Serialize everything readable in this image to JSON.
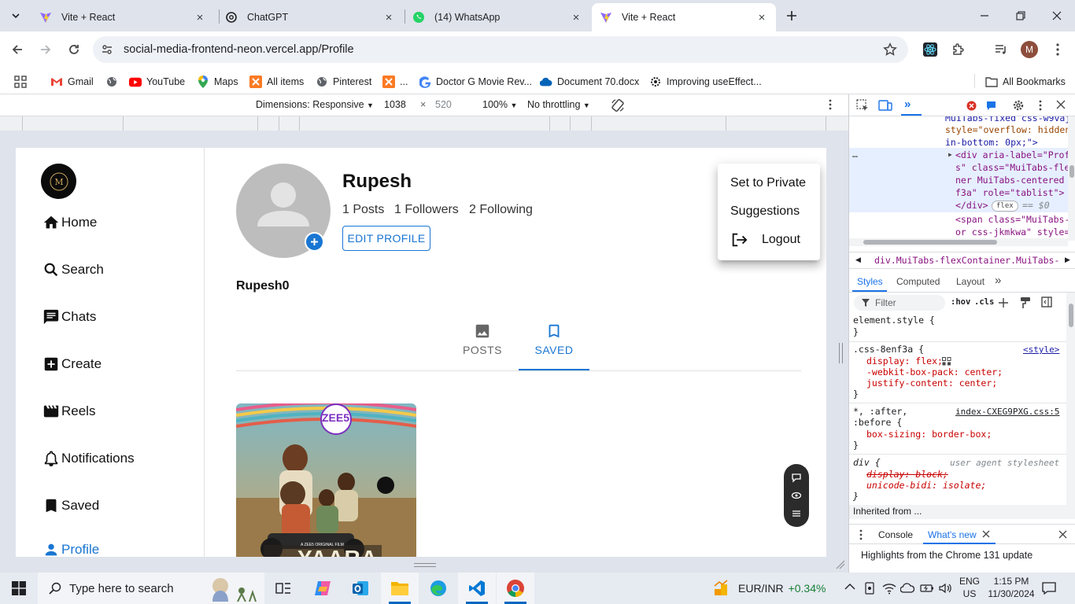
{
  "tabs": [
    {
      "title": "Vite + React",
      "favicon": "vite-icon"
    },
    {
      "title": "ChatGPT",
      "favicon": "chatgpt-icon"
    },
    {
      "title": "(14) WhatsApp",
      "favicon": "whatsapp-icon"
    },
    {
      "title": "Vite + React",
      "favicon": "vite-icon"
    }
  ],
  "address": {
    "url": "social-media-frontend-neon.vercel.app/Profile"
  },
  "bookmarks": [
    "Gmail",
    "YouTube",
    "Maps",
    "All items",
    "Pinterest",
    "...",
    "Doctor G Movie Rev...",
    "Document 70.docx",
    "Improving useEffect...",
    "All Bookmarks"
  ],
  "devicebar": {
    "dimensions": "Dimensions: Responsive",
    "width": "1038",
    "times": "×",
    "height": "520",
    "zoom": "100%",
    "throttle": "No throttling"
  },
  "sidebar": {
    "items": [
      {
        "label": "Home",
        "icon": "home-icon"
      },
      {
        "label": "Search",
        "icon": "search-icon"
      },
      {
        "label": "Chats",
        "icon": "chat-icon"
      },
      {
        "label": "Create",
        "icon": "add-box-icon"
      },
      {
        "label": "Reels",
        "icon": "movie-icon"
      },
      {
        "label": "Notifications",
        "icon": "bell-icon"
      },
      {
        "label": "Saved",
        "icon": "bookmark-icon"
      },
      {
        "label": "Profile",
        "icon": "person-icon"
      }
    ]
  },
  "profile": {
    "name": "Rupesh",
    "posts": "1 Posts",
    "followers": "1 Followers",
    "following": "2 Following",
    "edit_label": "EDIT PROFILE",
    "username": "Rupesh0",
    "tabs": [
      "POSTS",
      "SAVED"
    ],
    "active_tab": "SAVED"
  },
  "menu": {
    "items": [
      "Set to Private",
      "Suggestions",
      "Logout"
    ]
  },
  "poster": {
    "brand": "ZEE5",
    "title": "YAARA",
    "tagline": "A ZEE5 ORIGINAL FILM"
  },
  "devtools": {
    "html_lines": [
      "MuiTabs-fixed css-w9vaj",
      "style=\"overflow: hidden",
      "in-bottom: 0px;\">",
      "<div aria-label=\"Prof",
      "s\" class=\"MuiTabs-fle",
      "ner MuiTabs-centered",
      "f3a\" role=\"tablist\">",
      "</div>",
      "== $0",
      "<span class=\"MuiTabs-",
      "or css-jkmkwa\" style="
    ],
    "flex_badge": "flex",
    "breadcrumb": "div.MuiTabs-flexContainer.MuiTabs-centered",
    "panel_tabs": [
      "Styles",
      "Computed",
      "Layout"
    ],
    "filter_placeholder": "Filter",
    "hov": ":hov",
    "cls": ".cls",
    "rules": {
      "element_style": "element.style {",
      "close": "}",
      "css1_selector": ".css-8enf3a {",
      "css1_source": "<style>",
      "css1_props": [
        "display: flex;",
        "-webkit-box-pack: center;",
        "justify-content: center;"
      ],
      "css2_selector": "*, :after,",
      "css2_selector2": ":before {",
      "css2_source": "index-CXEG9PXG.css:5",
      "css2_props": [
        "box-sizing: border-box;"
      ],
      "css3_selector": "div {",
      "css3_source": "user agent stylesheet",
      "css3_props": [
        "display: block;",
        "unicode-bidi: isolate;"
      ]
    },
    "inherited": "Inherited from ...",
    "drawer_tabs": [
      "Console",
      "What's new"
    ],
    "whats_new": "Highlights from the Chrome 131 update"
  },
  "taskbar": {
    "search_placeholder": "Type here to search",
    "currency": "EUR/INR",
    "currency_change": "+0.34%",
    "lang1": "ENG",
    "lang2": "US",
    "time": "1:15 PM",
    "date": "11/30/2024"
  },
  "colors": {
    "mui_blue": "#1976d2",
    "chrome_blue": "#1a73e8",
    "positive_green": "#188038"
  }
}
